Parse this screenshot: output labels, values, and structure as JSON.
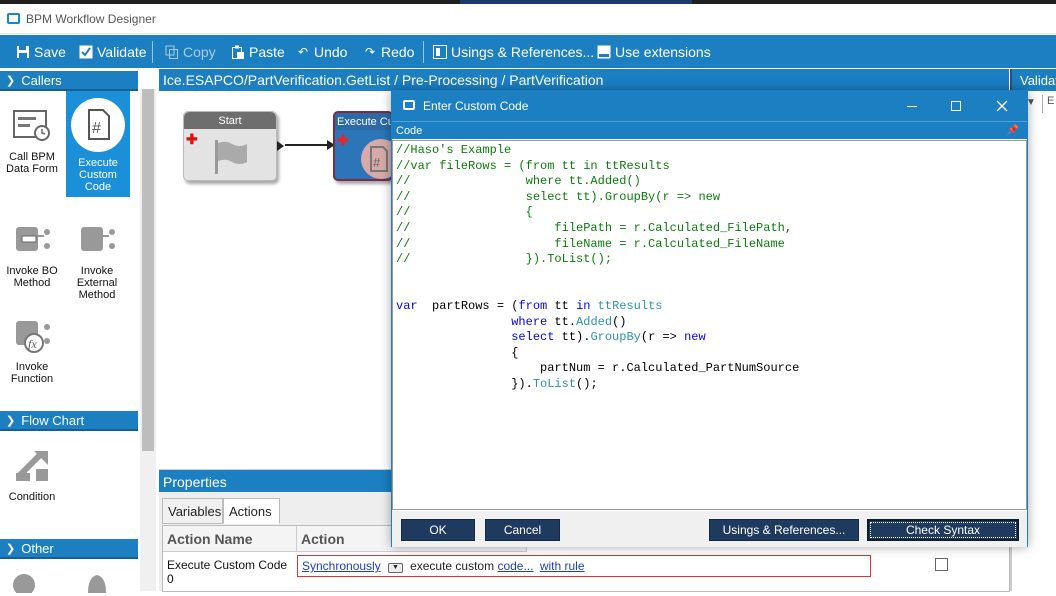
{
  "window": {
    "title": "BPM Workflow Designer"
  },
  "toolbar": {
    "save": "Save",
    "validate": "Validate",
    "copy": "Copy",
    "paste": "Paste",
    "undo": "Undo",
    "redo": "Redo",
    "usings": "Usings & References...",
    "extensions": "Use extensions"
  },
  "left": {
    "callers": "Callers",
    "flowchart": "Flow Chart",
    "other": "Other",
    "tools": {
      "call_bpm": "Call BPM Data Form",
      "execute_custom": "Execute Custom Code",
      "invoke_bo": "Invoke BO Method",
      "invoke_external": "Invoke External Method",
      "invoke_function": "Invoke Function",
      "condition": "Condition"
    }
  },
  "breadcrumb": "Ice.ESAPCO/PartVerification.GetList / Pre-Processing / PartVerification",
  "validation": {
    "header": "Validat"
  },
  "canvas": {
    "start_node": "Start",
    "exec_node": "Execute Cus"
  },
  "properties": {
    "header": "Properties",
    "tabs": [
      "Variables",
      "Actions"
    ],
    "columns": [
      "Action Name",
      "Action"
    ],
    "row": {
      "name": "Execute Custom Code 0",
      "sync": "Synchronously",
      "mid": "execute custom",
      "code": "code...",
      "rule": "with rule"
    }
  },
  "dialog": {
    "title": "Enter Custom Code",
    "code_header": "Code",
    "buttons": {
      "ok": "OK",
      "cancel": "Cancel",
      "usings": "Usings & References...",
      "check": "Check Syntax"
    },
    "code": [
      {
        "cls": "cm",
        "text": "//Haso's Example"
      },
      {
        "cls": "cm",
        "text": "//var fileRows = (from tt in ttResults"
      },
      {
        "cls": "cm",
        "text": "//                where tt.Added()"
      },
      {
        "cls": "cm",
        "text": "//                select tt).GroupBy(r => new"
      },
      {
        "cls": "cm",
        "text": "//                {"
      },
      {
        "cls": "cm",
        "text": "//                    filePath = r.Calculated_FilePath,"
      },
      {
        "cls": "cm",
        "text": "//                    fileName = r.Calculated_FileName"
      },
      {
        "cls": "cm",
        "text": "//                }).ToList();"
      },
      {
        "cls": "",
        "text": ""
      },
      {
        "cls": "",
        "text": ""
      },
      {
        "cls": "mix",
        "parts": [
          [
            "kw",
            "var"
          ],
          [
            "",
            "  partRows = ("
          ],
          [
            "kw",
            "from"
          ],
          [
            "",
            " tt "
          ],
          [
            "kw",
            "in"
          ],
          [
            "",
            " "
          ],
          [
            "ty",
            "ttResults"
          ]
        ]
      },
      {
        "cls": "mix",
        "parts": [
          [
            "",
            "                "
          ],
          [
            "kw",
            "where"
          ],
          [
            "",
            " tt."
          ],
          [
            "ty",
            "Added"
          ],
          [
            "",
            "()"
          ]
        ]
      },
      {
        "cls": "mix",
        "parts": [
          [
            "",
            "                "
          ],
          [
            "kw",
            "select"
          ],
          [
            "",
            " tt)."
          ],
          [
            "ty",
            "GroupBy"
          ],
          [
            "",
            "(r => "
          ],
          [
            "kw",
            "new"
          ]
        ]
      },
      {
        "cls": "",
        "text": "                {"
      },
      {
        "cls": "",
        "text": "                    partNum = r.Calculated_PartNumSource"
      },
      {
        "cls": "mix",
        "parts": [
          [
            "",
            "                })."
          ],
          [
            "ty",
            "ToList"
          ],
          [
            "",
            "();"
          ]
        ]
      }
    ]
  }
}
